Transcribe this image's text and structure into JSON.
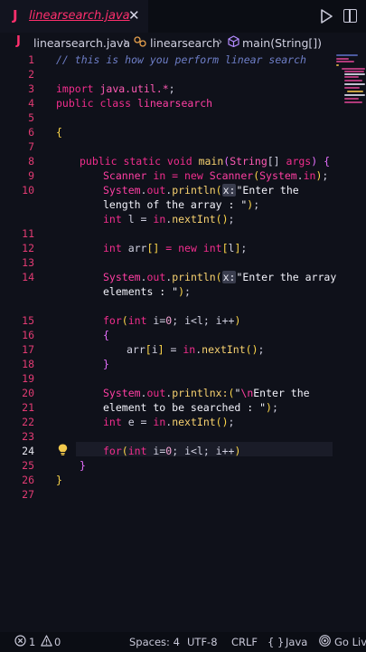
{
  "tab": {
    "label": "linearsearch.java",
    "file_icon": "J",
    "close": "✕"
  },
  "breadcrumb": {
    "file_icon": "J",
    "file": "linearsearch.java",
    "separator": "›",
    "class": "linearsearch",
    "method": "main(String[])"
  },
  "editor": {
    "line_numbers": [
      "1",
      "2",
      "3",
      "4",
      "5",
      "6",
      "7",
      "8",
      "9",
      "10",
      "11",
      "12",
      "13",
      "14",
      "15",
      "16",
      "17",
      "18",
      "19",
      "20",
      "21",
      "22",
      "23",
      "24",
      "25",
      "26",
      "27"
    ],
    "active_line": "25"
  },
  "statusbar": {
    "errors": "1",
    "warnings": "0",
    "spaces": "Spaces: 4",
    "encoding": "UTF-8",
    "eol": "CRLF",
    "language_icon": "{ }",
    "language": "Java",
    "golive": "Go Live"
  },
  "colors": {
    "background": "#0f111a",
    "keyword": "#f12d8d",
    "line_number": "#e23b73",
    "comment": "#6e7ec7",
    "function": "#f8d270"
  }
}
